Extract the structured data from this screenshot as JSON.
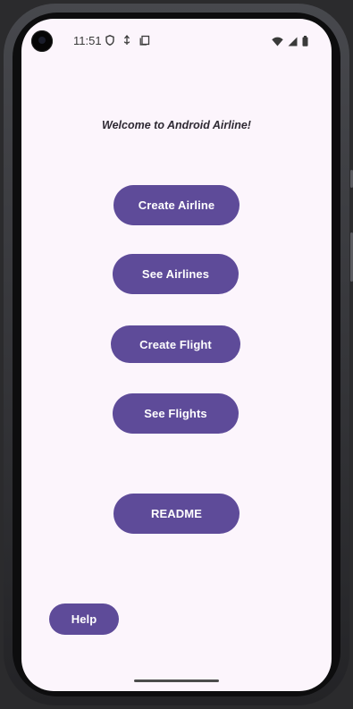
{
  "status_bar": {
    "time": "11:51",
    "left_icons": [
      "shield-icon",
      "usb-debug-icon",
      "clipboard-icon"
    ],
    "right_icons": [
      "wifi-icon",
      "cell-signal-icon",
      "battery-icon"
    ]
  },
  "main": {
    "welcome_text": "Welcome to Android Airline!",
    "buttons": {
      "create_airline": "Create Airline",
      "see_airlines": "See Airlines",
      "create_flight": "Create Flight",
      "see_flights": "See Flights",
      "readme": "README",
      "help": "Help"
    }
  },
  "colors": {
    "accent": "#5e4b99",
    "background": "#fcf5fc"
  }
}
